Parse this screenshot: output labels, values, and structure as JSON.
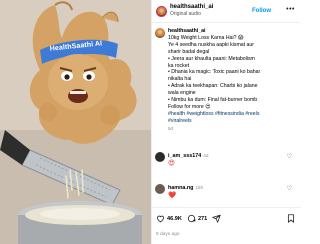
{
  "header": {
    "username": "healthsaathi_ai",
    "subtitle": "Original audio",
    "follow_label": "Follow",
    "more_label": "•••"
  },
  "media": {
    "headband_text": "HealthSaathi AI"
  },
  "caption": {
    "username": "healthsaathi_ai",
    "lines": [
      "10kg Weight Loss Karna Hai? 😱",
      "Ye 4 seedha nuskha aapki kismat aur",
      "sharir badal degal",
      "• Jeera aur khaulta paani: Metabolism",
      "ka rocket",
      "• Dhania ka magic: Toxic paani ko bahar",
      "nikalta hai",
      "• Adrak ka teekhapan: Charbi ko jalane",
      "wala engine",
      "• Nimbu ka dum: Final fat-burner bomb",
      "Follow for more 😍"
    ],
    "hashtags_line1": "#health #weightloss #fitnessindia #reels",
    "hashtags_line2": "#viralreels",
    "time": "5d"
  },
  "comments": [
    {
      "username": "i_am_sss174",
      "time": "4d",
      "text": "😍"
    },
    {
      "username": "hamna.ng",
      "time": "15h",
      "text": "❤️"
    }
  ],
  "actions": {
    "likes": "46.9K",
    "comments": "271"
  },
  "date": "5 days ago",
  "colors": {
    "accent": "#0095f6",
    "link": "#00376b"
  }
}
